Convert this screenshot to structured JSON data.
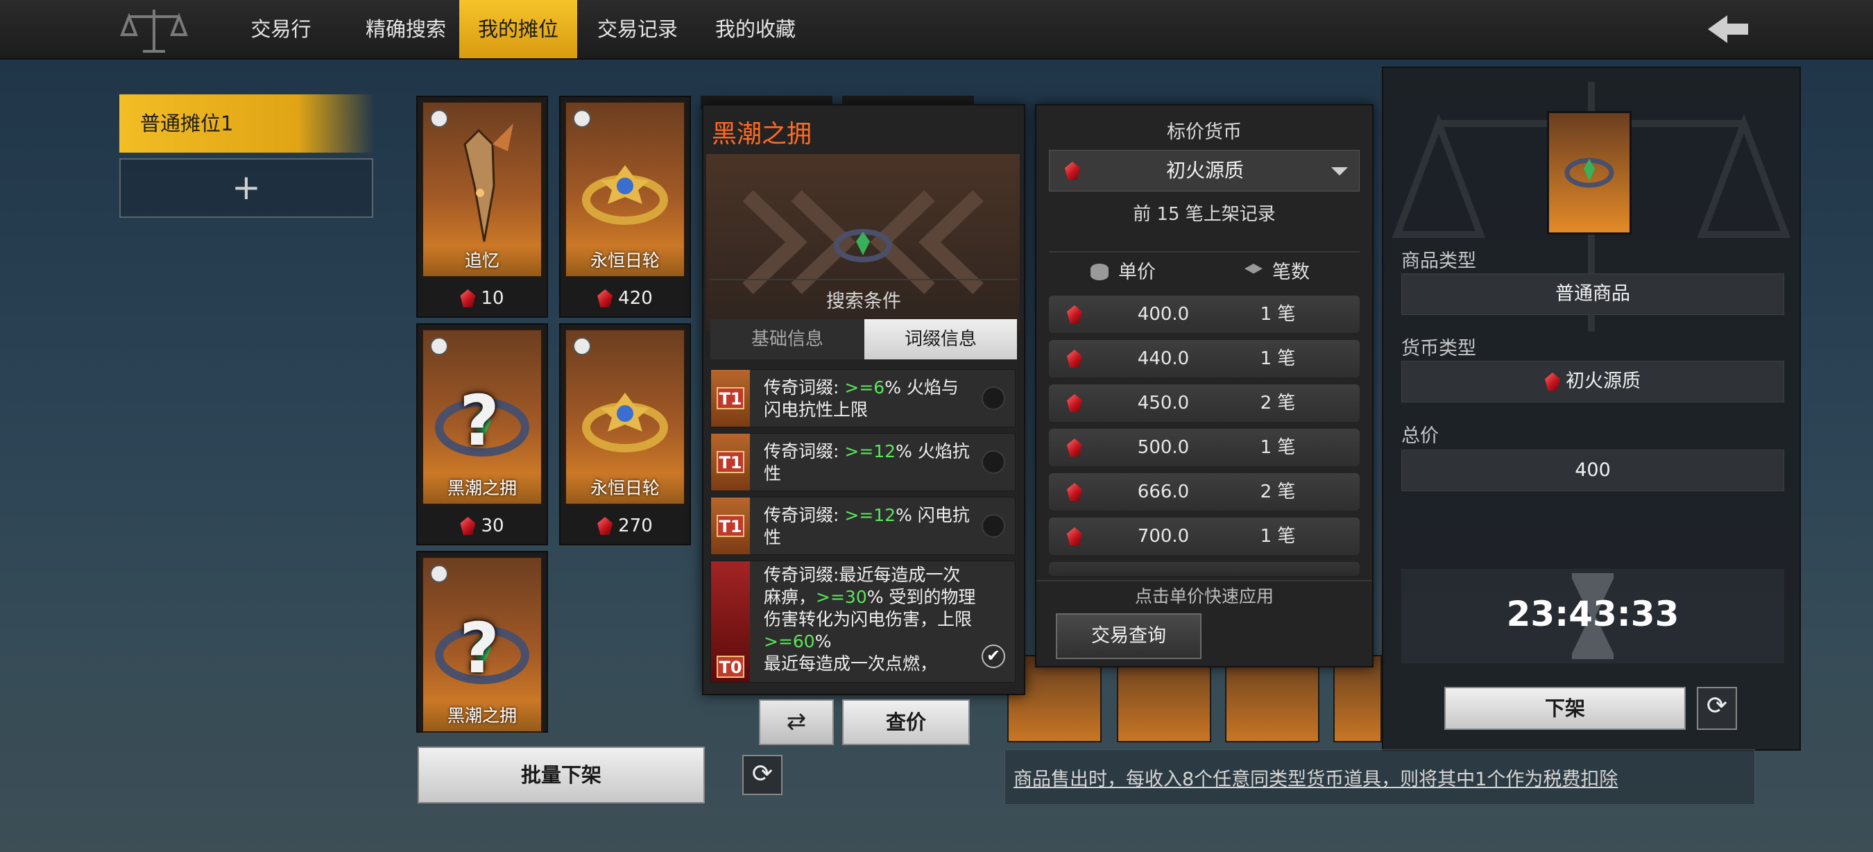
{
  "nav": {
    "tabs": [
      {
        "label": "交易行"
      },
      {
        "label": "精确搜索"
      },
      {
        "label": "我的摊位"
      },
      {
        "label": "交易记录"
      },
      {
        "label": "我的收藏"
      }
    ],
    "active_tab": "我的摊位",
    "logo_icon": "scales-icon",
    "back_icon": "back-arrow-icon"
  },
  "sidebar": {
    "stall_label": "普通摊位1",
    "add_label": "+"
  },
  "grid": {
    "items": [
      {
        "name": "追忆",
        "price": "10",
        "icon": "dagger-icon"
      },
      {
        "name": "永恒日轮",
        "price": "420",
        "icon": "gold-ring-icon"
      },
      {
        "name": "黑潮之拥",
        "price": "30",
        "icon": "unknown-ring-icon",
        "mark": "?"
      },
      {
        "name": "永恒日轮",
        "price": "270",
        "icon": "gold-ring-icon"
      },
      {
        "name": "黑潮之拥",
        "price": "",
        "icon": "unknown-ring-icon",
        "mark": "?"
      }
    ],
    "batch_button": "批量下架"
  },
  "popup": {
    "title": "黑潮之拥",
    "search_title": "搜索条件",
    "tabs": [
      "基础信息",
      "词缀信息"
    ],
    "active_tab": "词缀信息",
    "conditions": [
      {
        "tier": "T1",
        "prefix": "传奇词缀: ",
        "value": ">=6",
        "rest": "% 火焰与闪电抗性上限"
      },
      {
        "tier": "T1",
        "prefix": "传奇词缀: ",
        "value": ">=12",
        "rest": "% 火焰抗性"
      },
      {
        "tier": "T1",
        "prefix": "传奇词缀: ",
        "value": ">=12",
        "rest": "% 闪电抗性"
      },
      {
        "tier": "T0",
        "line1": "传奇词缀:最近每造成一次 麻痹，",
        "v1": ">=30",
        "line2": "% 受到的物理伤害转化为闪电伤害，上限 ",
        "v2": ">=60",
        "line3": "%",
        "line4": "最近每造成一次点燃，"
      }
    ],
    "refresh_button_icon": "swap-icon",
    "check_price_button": "查价"
  },
  "price_panel": {
    "currency_title": "标价货币",
    "currency_selected": "初火源质",
    "records_title": "前 15 笔上架记录",
    "col_unit": "单价",
    "col_count": "笔数",
    "rows": [
      {
        "unit": "400.0",
        "count": "1 笔"
      },
      {
        "unit": "440.0",
        "count": "1 笔"
      },
      {
        "unit": "450.0",
        "count": "2 笔"
      },
      {
        "unit": "500.0",
        "count": "1 笔"
      },
      {
        "unit": "666.0",
        "count": "2 笔"
      },
      {
        "unit": "700.0",
        "count": "1 笔"
      }
    ],
    "hint": "点击单价快速应用",
    "query_button": "交易查询"
  },
  "detail": {
    "type_label": "商品类型",
    "type_value": "普通商品",
    "currency_label": "货币类型",
    "currency_value": "初火源质",
    "total_label": "总价",
    "total_value": "400",
    "timer": "23:43:33",
    "delist_button": "下架"
  },
  "footer": {
    "tax_note": "商品售出时，每收入8个任意同类型货币道具，则将其中1个作为税费扣除"
  },
  "colors": {
    "accent": "#f2bd25",
    "item_orange": "#e38a27",
    "popup_title": "#ff6a22",
    "condition_green": "#5ce65c"
  }
}
